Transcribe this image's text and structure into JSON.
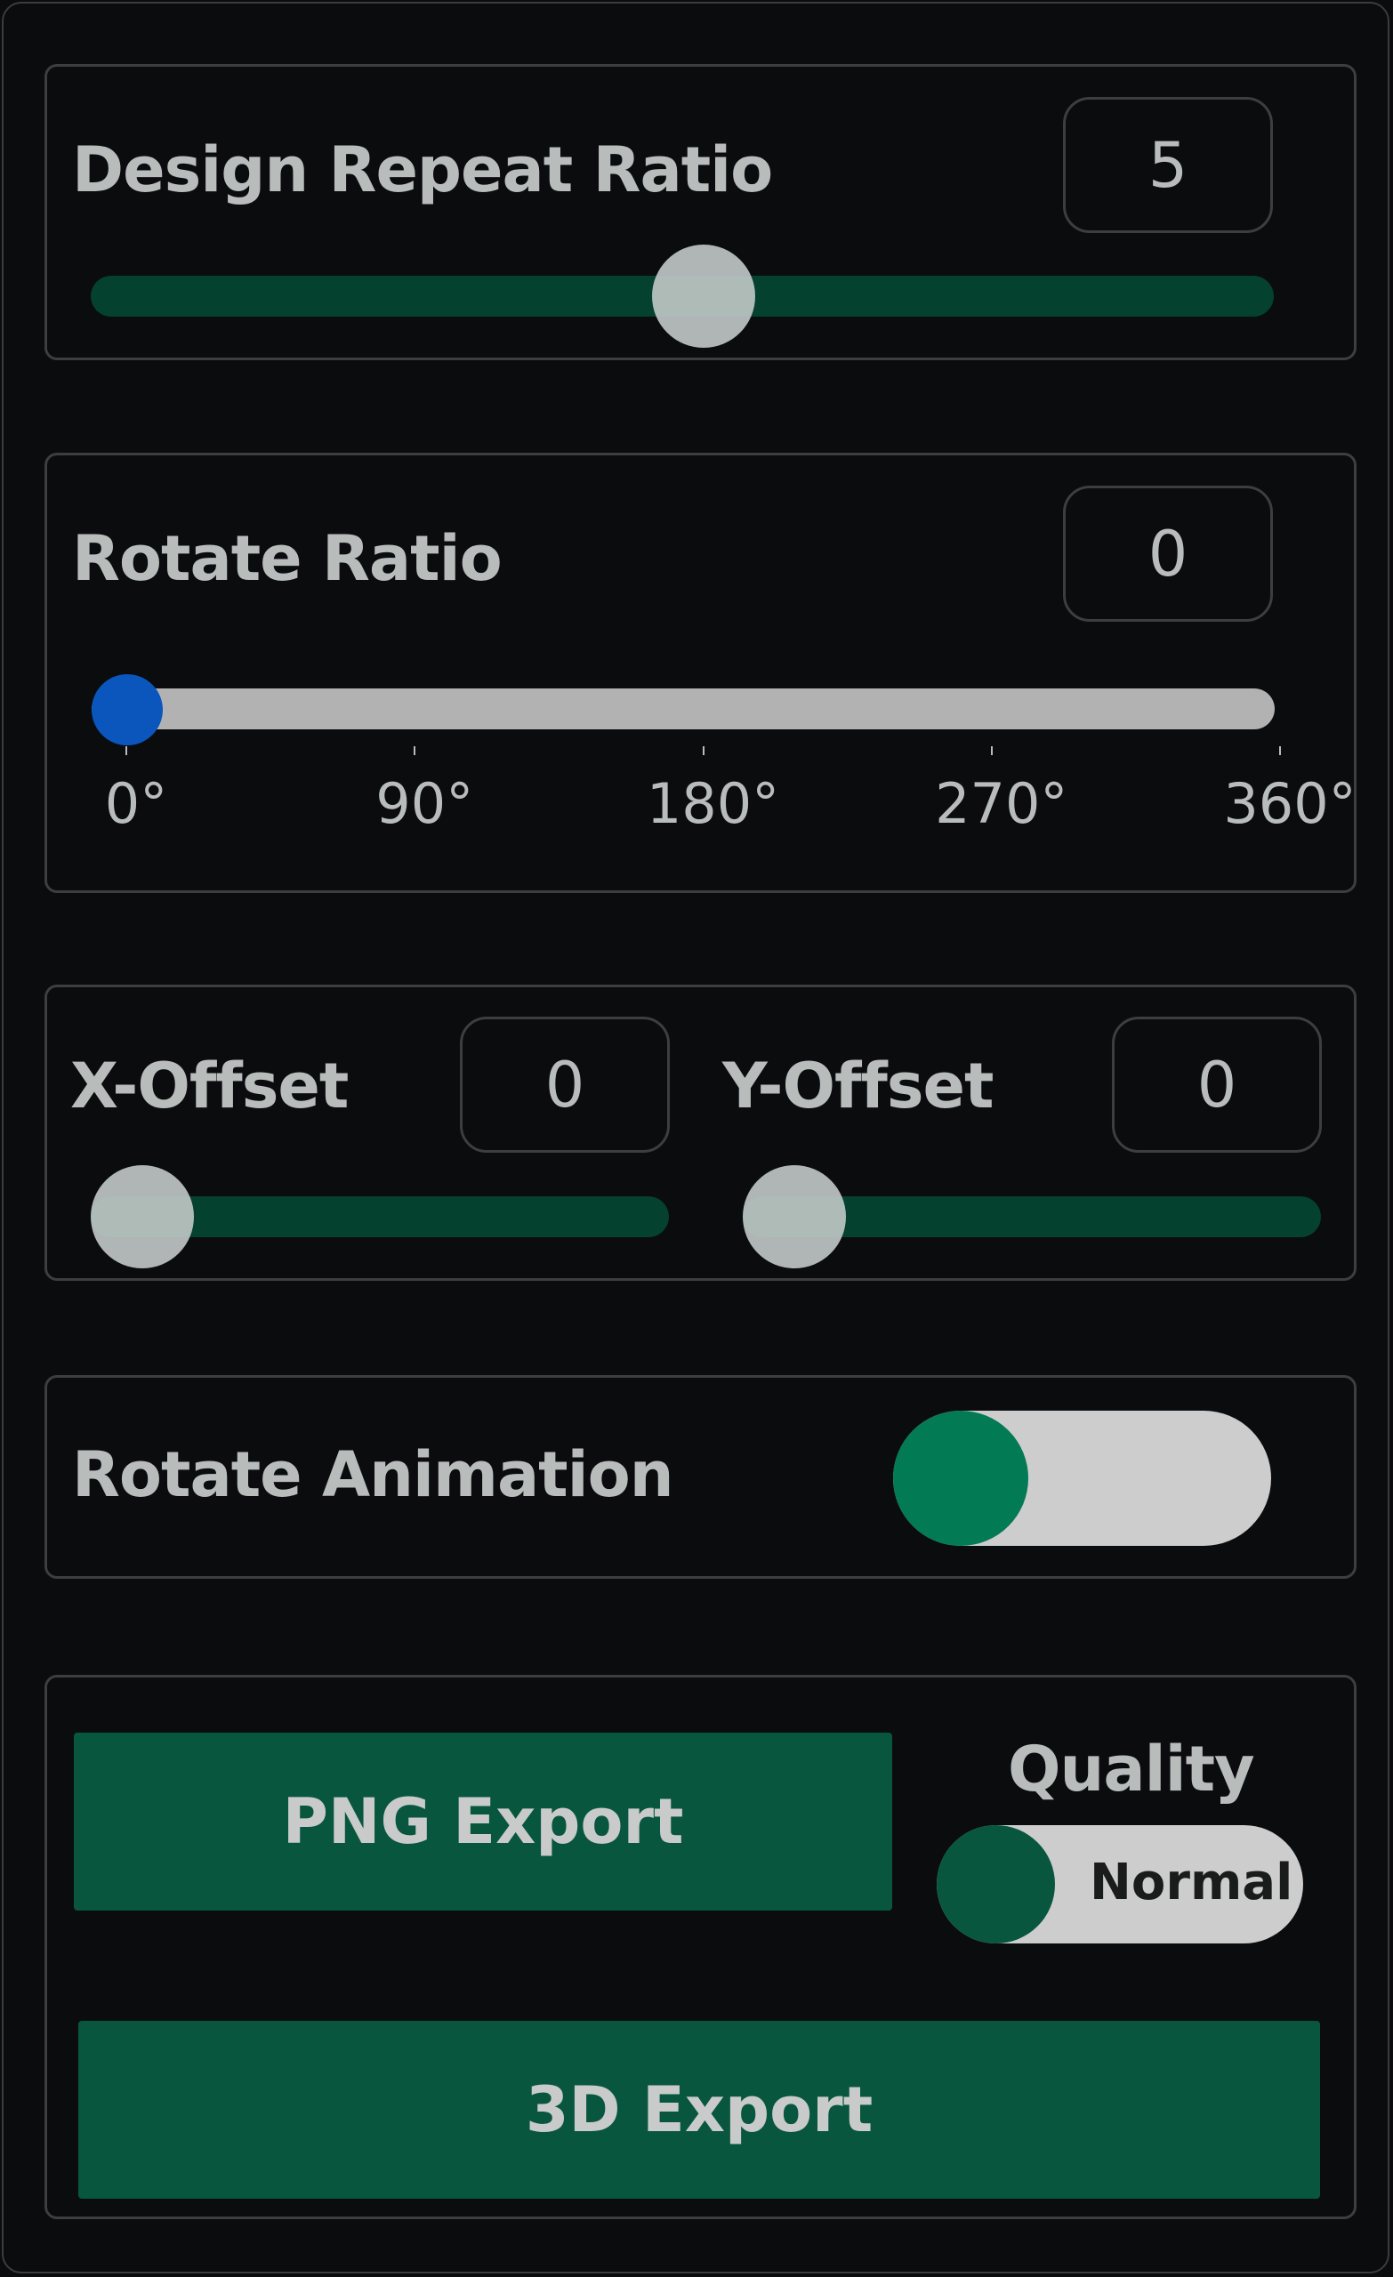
{
  "design_repeat": {
    "label": "Design Repeat Ratio",
    "value": "5",
    "slider_fraction": 0.52
  },
  "rotate_ratio": {
    "label": "Rotate Ratio",
    "value": "0",
    "slider_fraction": 0.0,
    "ticks": [
      "0°",
      "90°",
      "180°",
      "270°",
      "360°"
    ]
  },
  "offset": {
    "x": {
      "label": "X-Offset",
      "value": "0",
      "slider_fraction": 0.0
    },
    "y": {
      "label": "Y-Offset",
      "value": "0",
      "slider_fraction": 0.0
    }
  },
  "rotate_animation": {
    "label": "Rotate Animation",
    "enabled": false
  },
  "export": {
    "png_label": "PNG Export",
    "quality_label": "Quality",
    "quality_value": "Normal",
    "three_d_label": "3D Export"
  },
  "colors": {
    "accent_green": "#09563e",
    "track_green": "#04412f",
    "toggle_green": "#027a54",
    "rotate_thumb": "#0a56bd",
    "background": "#0a0c0e"
  }
}
